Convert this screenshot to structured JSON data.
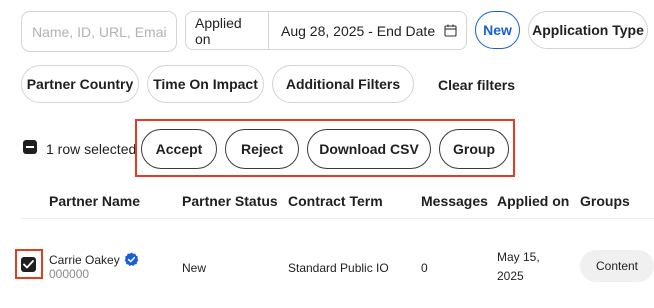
{
  "filters": {
    "search_placeholder": "Name, ID, URL, Email",
    "date_label": "Applied on",
    "date_value": "Aug 28, 2025 - End Date",
    "new_label": "New",
    "application_type_label": "Application Type",
    "partner_country_label": "Partner Country",
    "time_on_impact_label": "Time On Impact",
    "additional_filters_label": "Additional Filters",
    "clear_filters_label": "Clear filters",
    "accent_color": "#1a5fd6"
  },
  "selection": {
    "rows_selected_text": "1 row selected",
    "actions": {
      "accept": "Accept",
      "reject": "Reject",
      "download_csv": "Download CSV",
      "group": "Group"
    },
    "highlight_color": "#e23c22"
  },
  "table": {
    "columns": {
      "partner_name": "Partner Name",
      "partner_status": "Partner Status",
      "contract_term": "Contract Term",
      "messages": "Messages",
      "applied_on": "Applied on",
      "groups": "Groups"
    },
    "rows": [
      {
        "selected": true,
        "name": "Carrie Oakey",
        "id": "000000",
        "verified_icon": "verified-check-icon",
        "status": "New",
        "contract_term": "Standard Public IO",
        "messages": "0",
        "applied_on": "May 15, 2025",
        "groups": "Content"
      }
    ]
  }
}
